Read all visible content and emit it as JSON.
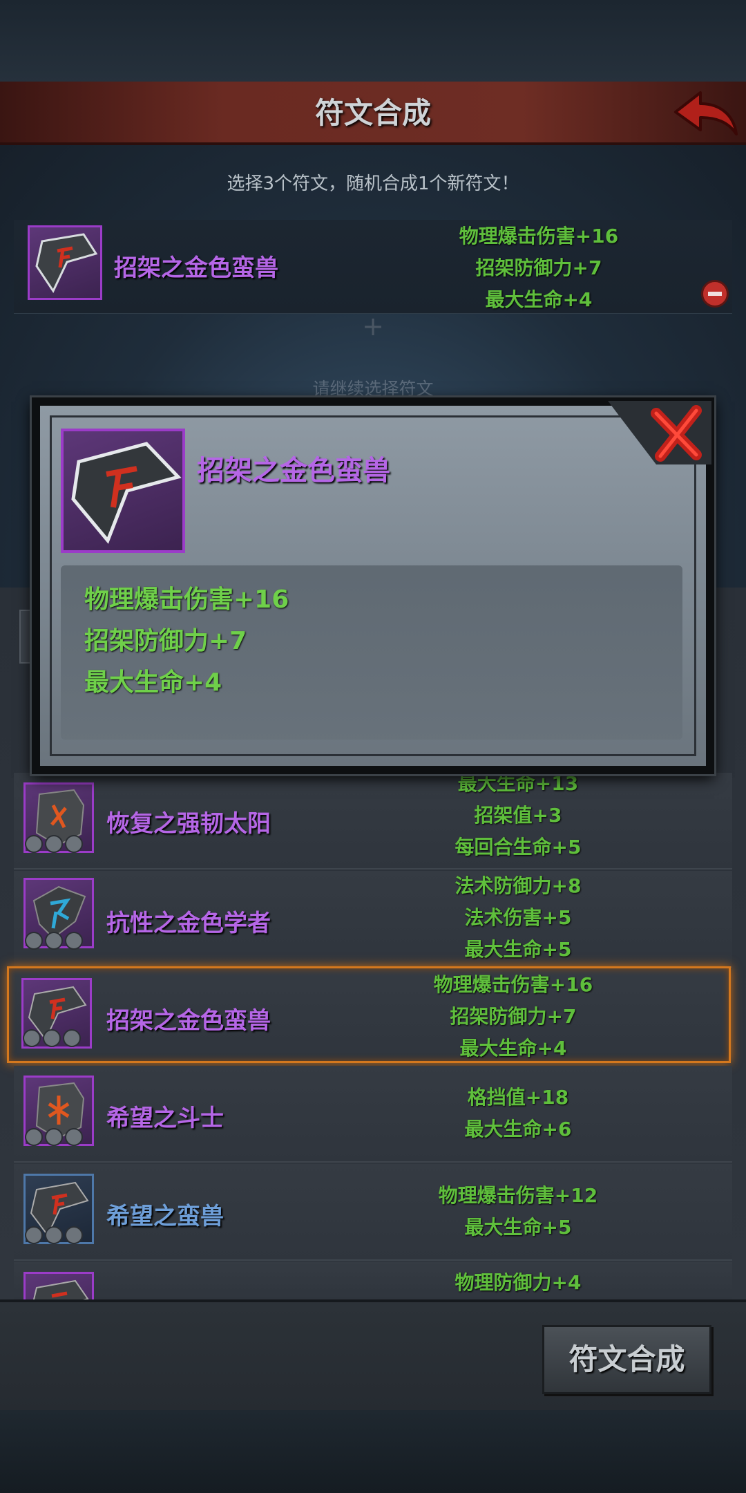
{
  "header": {
    "title": "符文合成"
  },
  "instruction": "选择3个符文，随机合成1个新符文！",
  "selected": {
    "name": "招架之金色蛮兽",
    "stats": [
      "物理爆击伤害+16",
      "招架防御力+7",
      "最大生命+4"
    ]
  },
  "continue_hint": "请继续选择符文",
  "popup": {
    "name": "招架之金色蛮兽",
    "stats": [
      "物理爆击伤害+16",
      "招架防御力+7",
      "最大生命+4"
    ]
  },
  "list": [
    {
      "name": "恢复之强韧太阳",
      "stats": [
        "最大生命+13",
        "招架值+3",
        "每回合生命+5"
      ],
      "quality": "purple",
      "glyph_color": "#e0571f"
    },
    {
      "name": "抗性之金色学者",
      "stats": [
        "法术防御力+8",
        "法术伤害+5",
        "最大生命+5"
      ],
      "quality": "purple",
      "glyph_color": "#2fa9d8"
    },
    {
      "name": "招架之金色蛮兽",
      "stats": [
        "物理爆击伤害+16",
        "招架防御力+7",
        "最大生命+4"
      ],
      "quality": "purple",
      "glyph_color": "#d0301f",
      "selected": true
    },
    {
      "name": "希望之斗士",
      "stats": [
        "格挡值+18",
        "最大生命+6"
      ],
      "quality": "purple",
      "glyph_color": "#e0571f"
    },
    {
      "name": "希望之蛮兽",
      "stats": [
        "物理爆击伤害+12",
        "最大生命+5"
      ],
      "quality": "blue",
      "glyph_color": "#d0301f"
    },
    {
      "name": "",
      "stats": [
        "物理防御力+4"
      ],
      "quality": "purple",
      "glyph_color": "#d0301f"
    }
  ],
  "compose_button": "符文合成",
  "colors": {
    "purple_name": "#b566e6",
    "blue_name": "#6e9fd9",
    "stat_green": "#5fbf3c",
    "selected_border": "#d4781e",
    "header_red": "#6a2a22"
  },
  "icons": [
    "back-arrow-icon",
    "remove-icon",
    "close-x-icon",
    "rune-icon"
  ]
}
